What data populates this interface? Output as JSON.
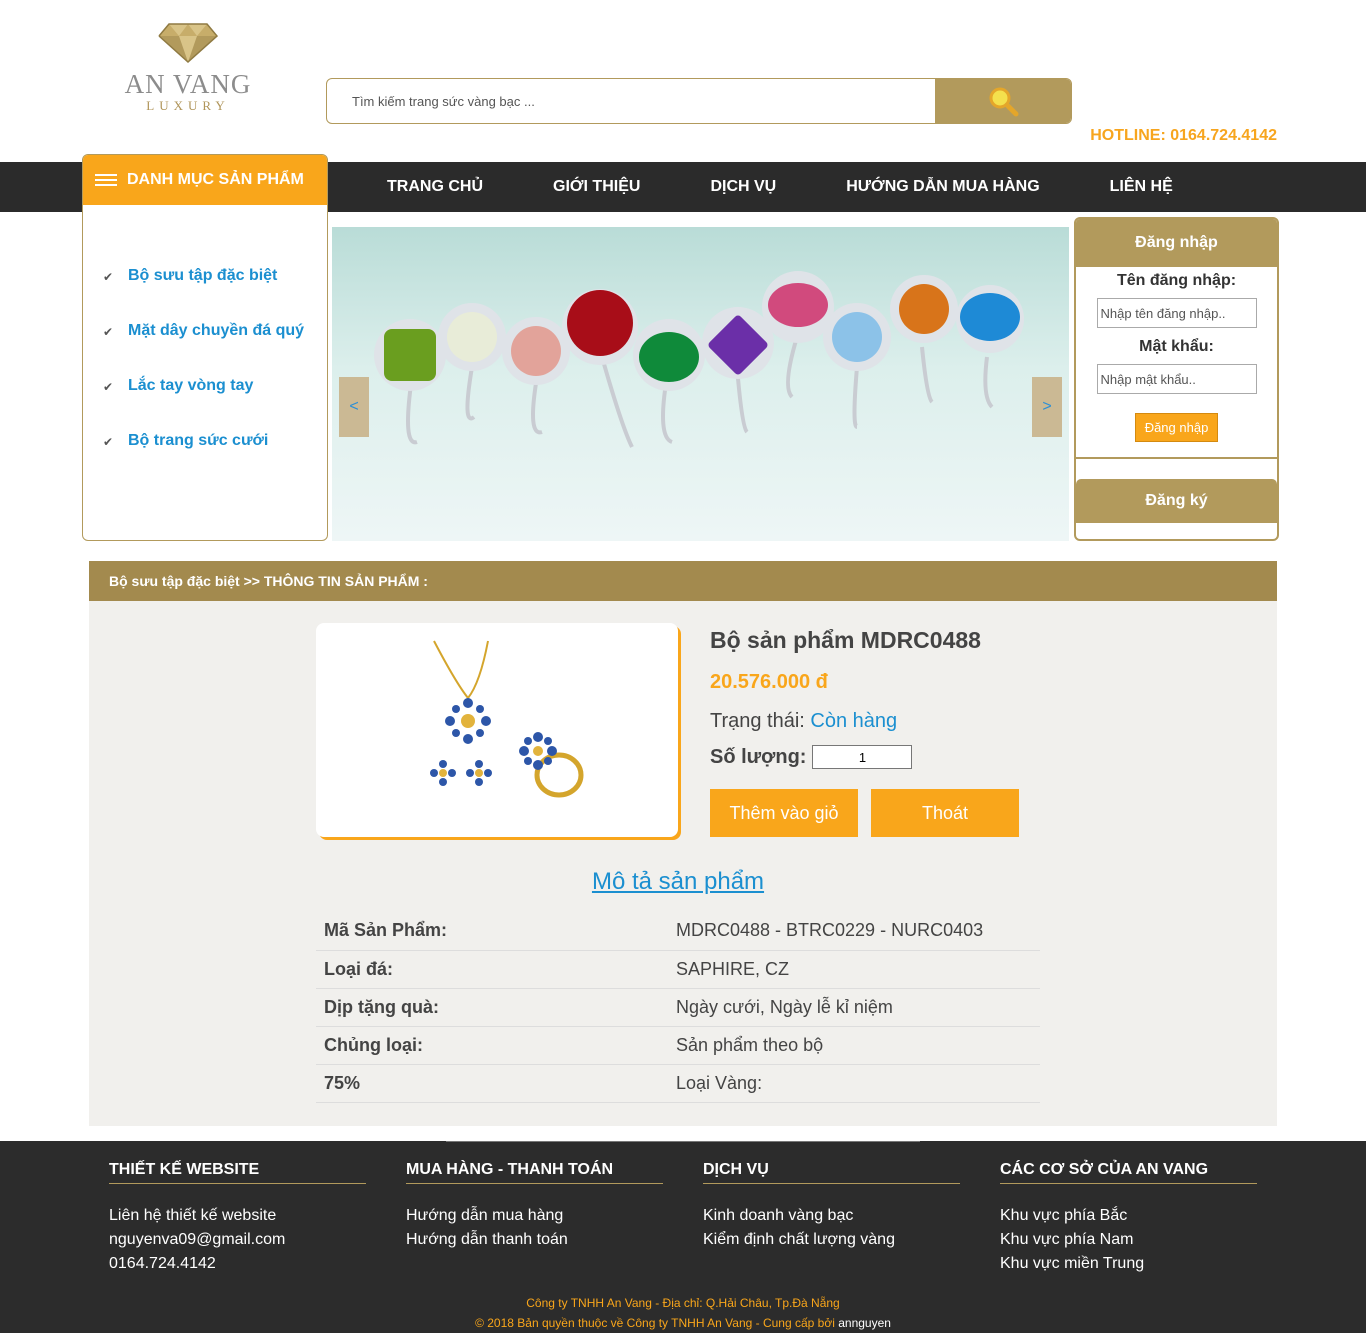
{
  "brand": {
    "name": "AN VANG",
    "tagline": "LUXURY"
  },
  "search": {
    "placeholder": "Tìm kiếm trang sức vàng bạc ..."
  },
  "hotline": "HOTLINE: 0164.724.4142",
  "nav": [
    "TRANG CHỦ",
    "GIỚI THIỆU",
    "DỊCH VỤ",
    "HƯỚNG DẪN MUA HÀNG",
    "LIÊN HỆ"
  ],
  "categories": {
    "title": "DANH MỤC SẢN PHẨM",
    "items": [
      "Bộ sưu tập đặc biệt",
      "Mặt dây chuyền đá quý",
      "Lắc tay vòng tay",
      "Bộ trang sức cưới"
    ]
  },
  "slider": {
    "prev": "<",
    "next": ">"
  },
  "login": {
    "title": "Đăng nhập",
    "user_label": "Tên đăng nhập:",
    "user_placeholder": "Nhập tên đăng nhập..",
    "pass_label": "Mật khẩu:",
    "pass_placeholder": "Nhập mật khẩu..",
    "button": "Đăng nhập",
    "register": "Đăng ký"
  },
  "breadcrumb": {
    "parent": "Bộ sưu tập đặc biệt",
    "sep": " >> ",
    "current": "THÔNG TIN SẢN PHẨM :"
  },
  "product": {
    "name": "Bộ sản phẩm MDRC0488",
    "price": "20.576.000 đ",
    "status_label": "Trạng thái: ",
    "status_value": "Còn hàng",
    "qty_label": "Số lượng:",
    "qty_value": "1",
    "add_to_cart": "Thêm vào giỏ",
    "exit": "Thoát",
    "desc_title": "Mô tả sản phẩm",
    "specs": [
      {
        "key": "Mã Sản Phẩm:",
        "value": "MDRC0488 - BTRC0229 - NURC0403"
      },
      {
        "key": "Loại đá:",
        "value": "SAPHIRE, CZ"
      },
      {
        "key": "Dịp tặng quà:",
        "value": "Ngày cưới, Ngày lễ kỉ niệm"
      },
      {
        "key": "Chủng loại:",
        "value": "Sản phẩm theo bộ"
      },
      {
        "key": "75%",
        "value": "Loại Vàng:"
      }
    ]
  },
  "footer": {
    "cols": [
      {
        "title": "THIẾT KẾ WEBSITE",
        "items": [
          "Liên hệ thiết kế website",
          "nguyenva09@gmail.com",
          "0164.724.4142"
        ]
      },
      {
        "title": "MUA HÀNG - THANH TOÁN",
        "items": [
          "Hướng dẫn mua hàng",
          "Hướng dẫn thanh toán"
        ]
      },
      {
        "title": "DỊCH VỤ",
        "items": [
          "Kinh doanh vàng bạc",
          "Kiểm định chất lượng vàng"
        ]
      },
      {
        "title": "CÁC CƠ SỞ CỦA AN VANG",
        "items": [
          "Khu vực phía Bắc",
          "Khu vực phía Nam",
          "Khu vực miền Trung"
        ]
      }
    ],
    "address": "Công ty TNHH An Vang - Địa chỉ: Q.Hải Châu, Tp.Đà Nẵng",
    "copyright": "© 2018 Bản quyền thuộc về Công ty TNHH An Vang - Cung cấp bởi ",
    "provider": "annguyen"
  },
  "colors": {
    "gold": "#b29a5c",
    "orange": "#f9a61b",
    "blue": "#1b8fd0",
    "dark": "#2b2b2b"
  }
}
